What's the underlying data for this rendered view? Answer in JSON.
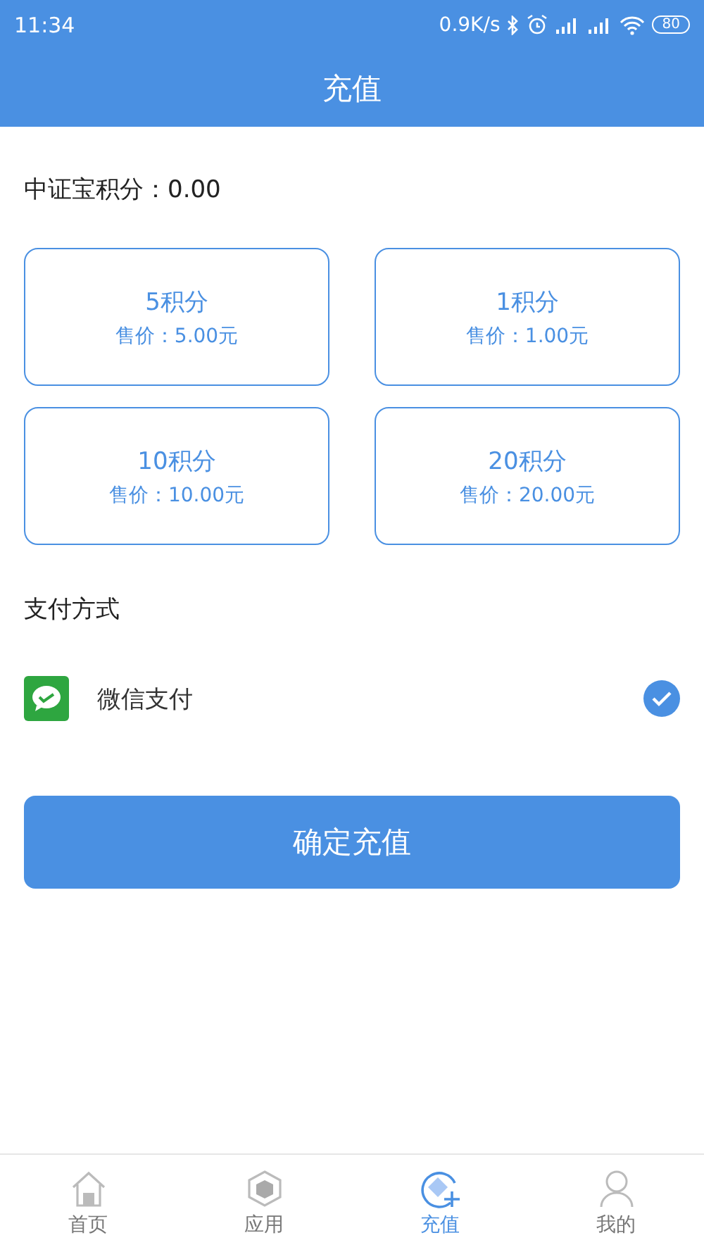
{
  "status_bar": {
    "time": "11:34",
    "speed": "0.9K/s",
    "battery": "80"
  },
  "header": {
    "title": "充值"
  },
  "balance": {
    "label": "中证宝积分：0.00"
  },
  "packages": [
    {
      "points": "5积分",
      "price": "售价：5.00元"
    },
    {
      "points": "1积分",
      "price": "售价：1.00元"
    },
    {
      "points": "10积分",
      "price": "售价：10.00元"
    },
    {
      "points": "20积分",
      "price": "售价：20.00元"
    }
  ],
  "payment": {
    "title": "支付方式",
    "methods": [
      {
        "label": "微信支付",
        "checked": true
      }
    ]
  },
  "submit_button": "确定充值",
  "tabs": [
    {
      "kind": "home",
      "label": "首页",
      "selected": false
    },
    {
      "kind": "apps",
      "label": "应用",
      "selected": false
    },
    {
      "kind": "recharge",
      "label": "充值",
      "selected": true
    },
    {
      "kind": "profile",
      "label": "我的",
      "selected": false
    }
  ]
}
